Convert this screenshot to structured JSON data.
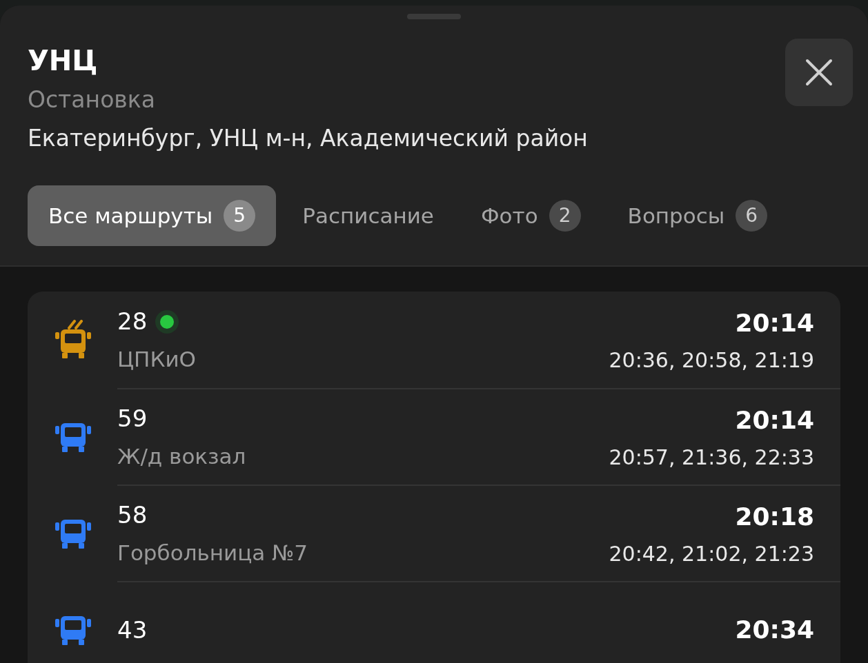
{
  "stop": {
    "title": "УНЦ",
    "type": "Остановка",
    "address": "Екатеринбург, УНЦ м-н, Академический район"
  },
  "tabs": [
    {
      "label": "Все маршруты",
      "count": "5",
      "selected": true
    },
    {
      "label": "Расписание",
      "selected": false
    },
    {
      "label": "Фото",
      "count": "2",
      "selected": false
    },
    {
      "label": "Вопросы",
      "count": "6",
      "selected": false
    }
  ],
  "routes": [
    {
      "kind": "trolleybus",
      "color": "#d4920f",
      "number": "28",
      "live": true,
      "destination": "ЦПКиО",
      "next": "20:14",
      "later": "20:36, 20:58, 21:19"
    },
    {
      "kind": "bus",
      "color": "#2f7bf5",
      "number": "59",
      "live": false,
      "destination": "Ж/д вокзал",
      "next": "20:14",
      "later": "20:57, 21:36, 22:33"
    },
    {
      "kind": "bus",
      "color": "#2f7bf5",
      "number": "58",
      "live": false,
      "destination": "Горбольница №7",
      "next": "20:18",
      "later": "20:42, 21:02, 21:23"
    },
    {
      "kind": "bus",
      "color": "#2f7bf5",
      "number": "43",
      "live": false,
      "next": "20:34"
    }
  ]
}
